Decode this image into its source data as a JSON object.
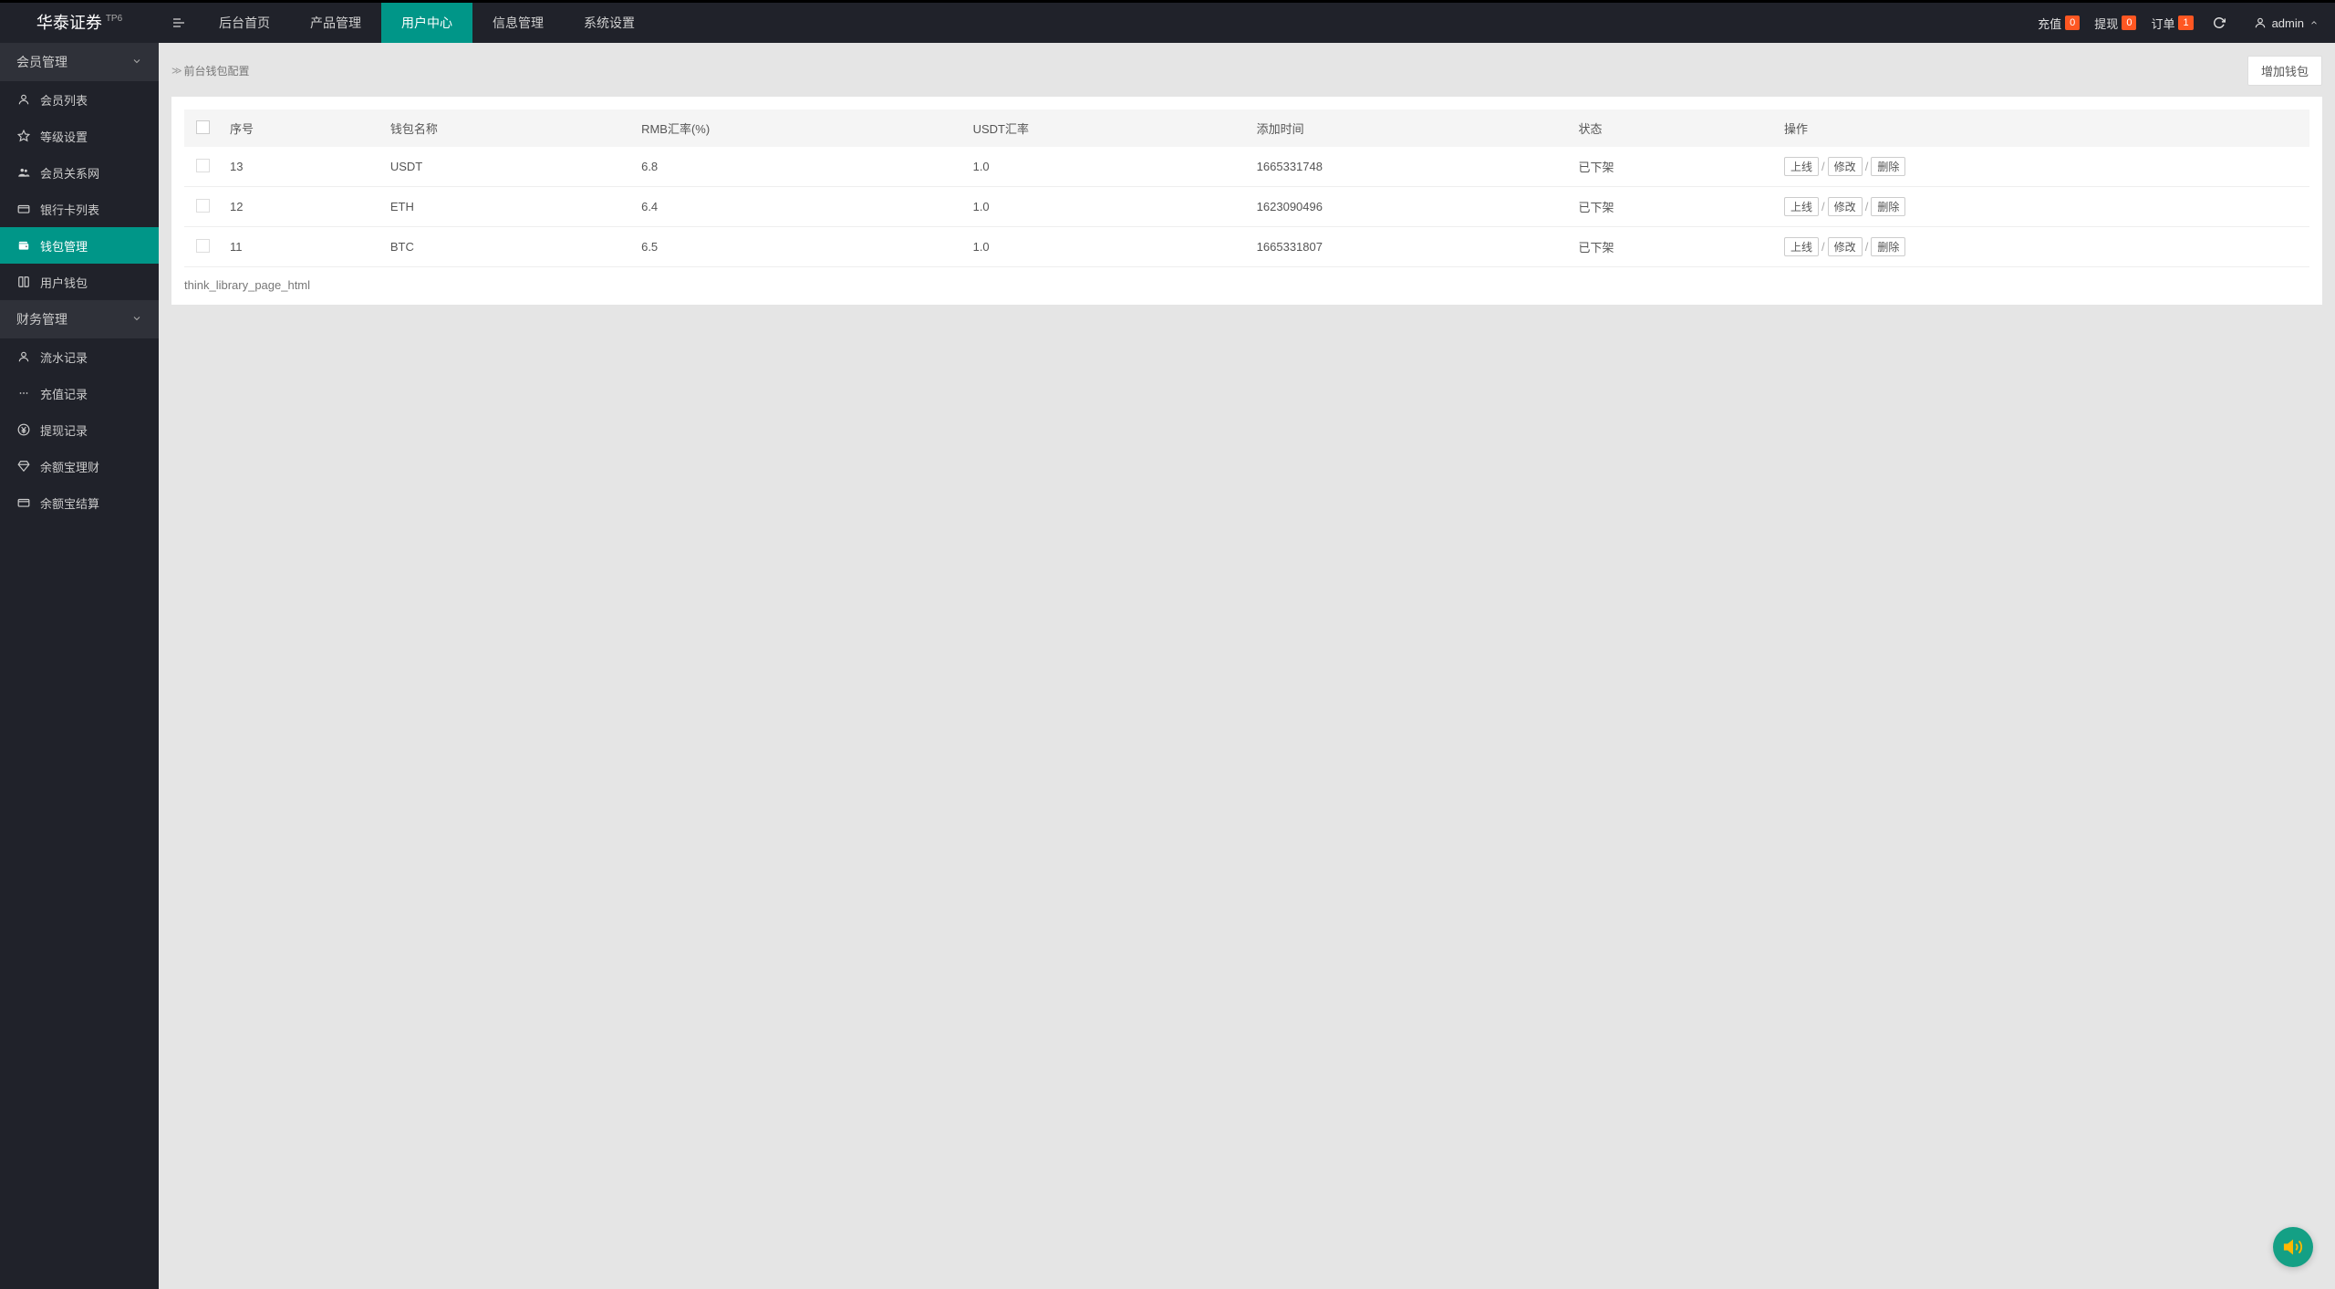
{
  "brand": {
    "title": "华泰证券",
    "super": "TP6"
  },
  "nav": {
    "items": [
      {
        "label": "后台首页",
        "active": false
      },
      {
        "label": "产品管理",
        "active": false
      },
      {
        "label": "用户中心",
        "active": true
      },
      {
        "label": "信息管理",
        "active": false
      },
      {
        "label": "系统设置",
        "active": false
      }
    ]
  },
  "headerRight": {
    "recharge": {
      "label": "充值",
      "badge": "0"
    },
    "withdraw": {
      "label": "提现",
      "badge": "0"
    },
    "orders": {
      "label": "订单",
      "badge": "1"
    },
    "user": "admin"
  },
  "sidebar": {
    "group1": {
      "label": "会员管理"
    },
    "items1": [
      {
        "icon": "user",
        "label": "会员列表",
        "active": false
      },
      {
        "icon": "star",
        "label": "等级设置",
        "active": false
      },
      {
        "icon": "users",
        "label": "会员关系网",
        "active": false
      },
      {
        "icon": "card",
        "label": "银行卡列表",
        "active": false
      },
      {
        "icon": "wallet",
        "label": "钱包管理",
        "active": true
      },
      {
        "icon": "book",
        "label": "用户钱包",
        "active": false
      }
    ],
    "group2": {
      "label": "财务管理"
    },
    "items2": [
      {
        "icon": "user",
        "label": "流水记录",
        "active": false
      },
      {
        "icon": "dots",
        "label": "充值记录",
        "active": false
      },
      {
        "icon": "yen",
        "label": "提现记录",
        "active": false
      },
      {
        "icon": "diamond",
        "label": "余额宝理财",
        "active": false
      },
      {
        "icon": "card",
        "label": "余额宝结算",
        "active": false
      }
    ]
  },
  "breadcrumb": {
    "text": "前台钱包配置"
  },
  "addButton": "增加钱包",
  "table": {
    "headers": [
      "序号",
      "钱包名称",
      "RMB汇率(%)",
      "USDT汇率",
      "添加时间",
      "状态",
      "操作"
    ],
    "rows": [
      {
        "id": "13",
        "name": "USDT",
        "rmb": "6.8",
        "usdt": "1.0",
        "time": "1665331748",
        "status": "已下架"
      },
      {
        "id": "12",
        "name": "ETH",
        "rmb": "6.4",
        "usdt": "1.0",
        "time": "1623090496",
        "status": "已下架"
      },
      {
        "id": "11",
        "name": "BTC",
        "rmb": "6.5",
        "usdt": "1.0",
        "time": "1665331807",
        "status": "已下架"
      }
    ],
    "actions": {
      "online": "上线",
      "edit": "修改",
      "delete": "删除"
    }
  },
  "footerText": "think_library_page_html"
}
